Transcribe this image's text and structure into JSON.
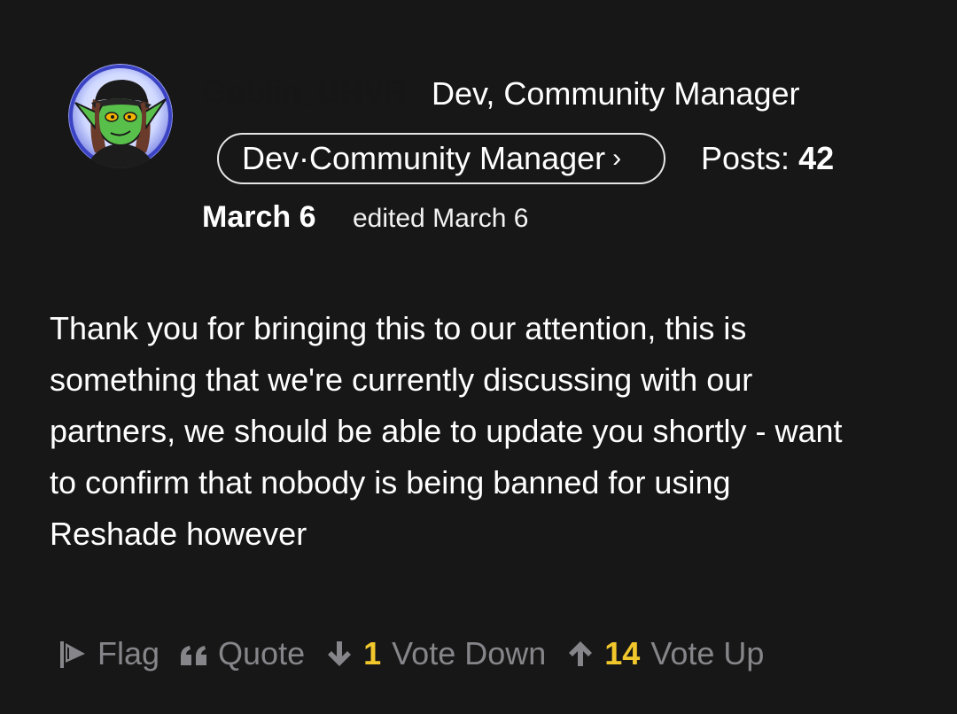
{
  "author": {
    "username": "Goblin_BHVR",
    "title": "Dev, Community Manager",
    "role_badge": "Dev·Community Manager",
    "role_chevron": "›",
    "posts_label": "Posts:",
    "posts_count": "42",
    "avatar_icon": "goblin-avatar-icon"
  },
  "meta": {
    "date": "March 6",
    "edited": "edited March 6"
  },
  "body": {
    "lines": [
      "Thank you for bringing this to our attention, this is",
      "something that we're currently discussing with our",
      "partners, we should be able to update you shortly - want",
      "to confirm that nobody is being banned for using",
      "Reshade however"
    ]
  },
  "actions": {
    "flag": {
      "label": "Flag",
      "icon": "flag-icon"
    },
    "quote": {
      "label": "Quote",
      "icon": "quote-icon"
    },
    "vote_down": {
      "label": "Vote Down",
      "count": "1",
      "icon": "arrow-down-icon"
    },
    "vote_up": {
      "label": "Vote Up",
      "count": "14",
      "icon": "arrow-up-icon"
    }
  },
  "colors": {
    "background": "#171718",
    "text": "#ffffff",
    "muted": "#86868a",
    "vote_count": "#f1c72c"
  }
}
